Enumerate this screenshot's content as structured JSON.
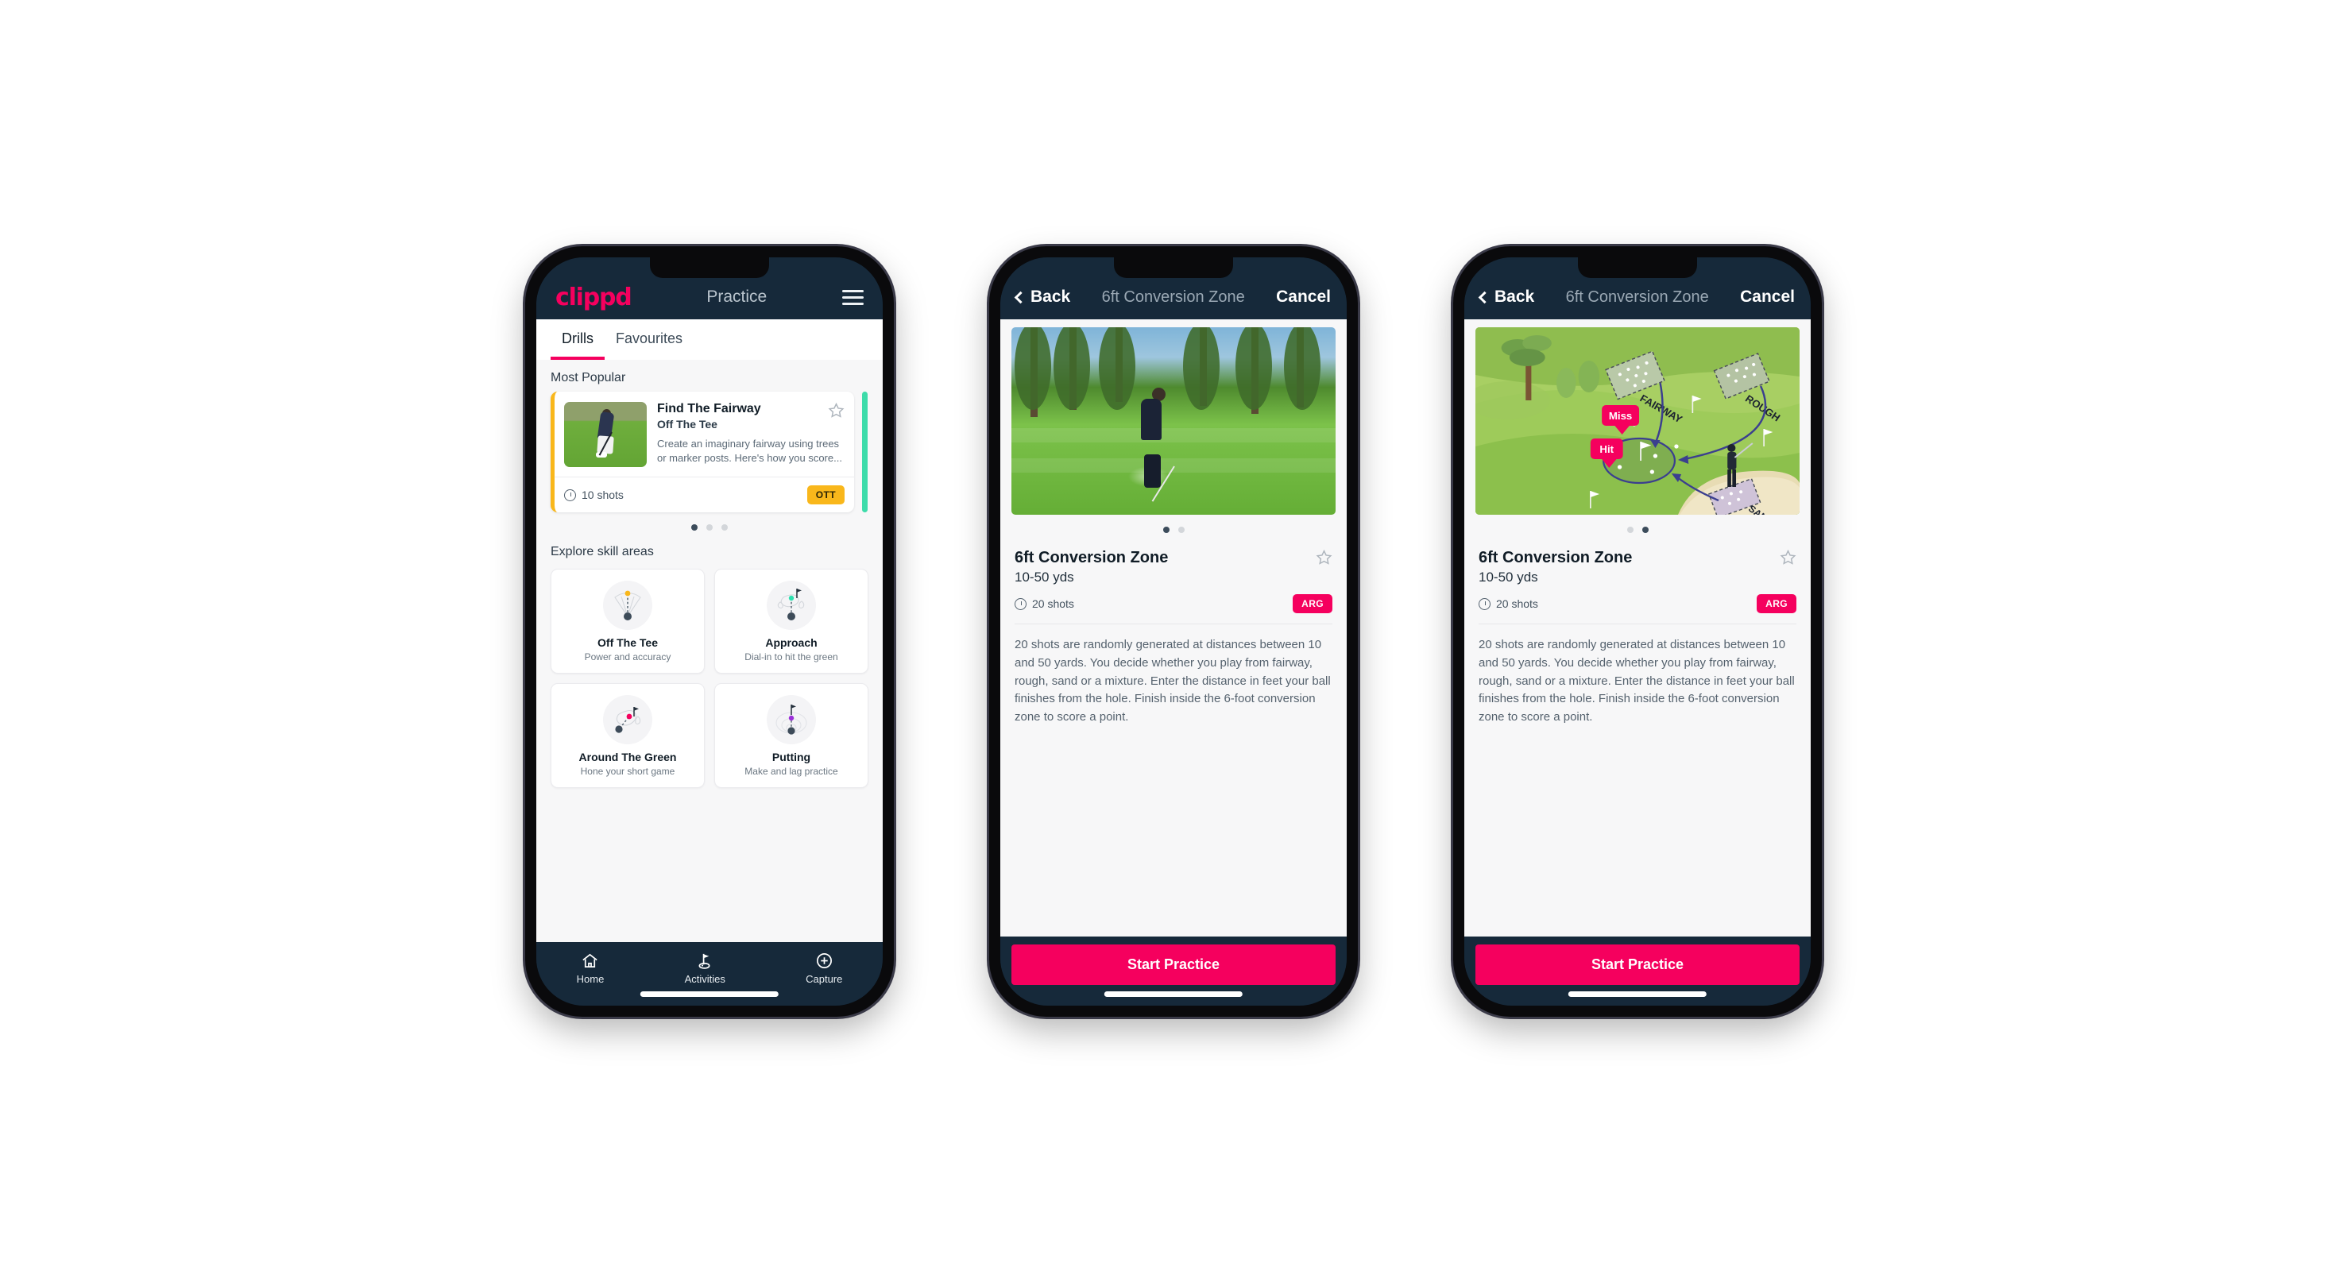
{
  "phone1": {
    "header": {
      "logo": "clippd",
      "title": "Practice",
      "menu_icon": "hamburger-menu-icon"
    },
    "tabs": [
      {
        "label": "Drills",
        "active": true
      },
      {
        "label": "Favourites",
        "active": false
      }
    ],
    "most_popular_label": "Most Popular",
    "featured_card": {
      "title": "Find The Fairway",
      "subtitle": "Off The Tee",
      "description": "Create an imaginary fairway using trees or marker posts. Here's how you score...",
      "shots": "10 shots",
      "badge": "OTT",
      "badge_color": "#f9b71b",
      "accent_color": "#f9b71b",
      "next_card_color": "#3ddcaa",
      "star_icon": "star-outline-icon",
      "thumbnail": "golfer-driving-photo"
    },
    "carousel_dots": {
      "count": 3,
      "active_index": 0
    },
    "explore_label": "Explore skill areas",
    "skills": [
      {
        "name": "Off The Tee",
        "desc": "Power and accuracy",
        "icon": "tee-dispersion-icon",
        "dot_color": "#f9b71b"
      },
      {
        "name": "Approach",
        "desc": "Dial-in to hit the green",
        "icon": "approach-green-icon",
        "dot_color": "#2ee0b0"
      },
      {
        "name": "Around The Green",
        "desc": "Hone your short game",
        "icon": "around-green-icon",
        "dot_color": "#f5005e"
      },
      {
        "name": "Putting",
        "desc": "Make and lag practice",
        "icon": "putting-rings-icon",
        "dot_color": "#9b30d9"
      }
    ],
    "bottom_nav": [
      {
        "label": "Home",
        "icon": "home-icon",
        "active": false
      },
      {
        "label": "Activities",
        "icon": "golf-flag-icon",
        "active": true
      },
      {
        "label": "Capture",
        "icon": "plus-circle-icon",
        "active": false
      }
    ]
  },
  "phone2": {
    "nav": {
      "back": "Back",
      "title": "6ft Conversion Zone",
      "cancel": "Cancel",
      "back_icon": "chevron-left-icon"
    },
    "media": "golfer-chipping-photo",
    "carousel_dots": {
      "count": 2,
      "active_index": 0
    },
    "detail": {
      "title": "6ft Conversion Zone",
      "subtitle": "10-50 yds",
      "shots": "20 shots",
      "badge": "ARG",
      "badge_color": "#f5005e",
      "star_icon": "star-outline-icon",
      "description": "20 shots are randomly generated at distances between 10 and 50 yards. You decide whether you play from fairway, rough, sand or a mixture. Enter the distance in feet your ball finishes from the hole. Finish inside the 6-foot conversion zone to score a point."
    },
    "cta": {
      "label": "Start Practice",
      "color": "#f5005e"
    }
  },
  "phone3": {
    "nav": {
      "back": "Back",
      "title": "6ft Conversion Zone",
      "cancel": "Cancel",
      "back_icon": "chevron-left-icon"
    },
    "media": "course-diagram-illustration",
    "illustration_labels": {
      "fairway": "FAIRWAY",
      "rough": "ROUGH",
      "sand": "SAND",
      "miss": "Miss",
      "hit": "Hit"
    },
    "carousel_dots": {
      "count": 2,
      "active_index": 1
    },
    "detail": {
      "title": "6ft Conversion Zone",
      "subtitle": "10-50 yds",
      "shots": "20 shots",
      "badge": "ARG",
      "badge_color": "#f5005e",
      "star_icon": "star-outline-icon",
      "description": "20 shots are randomly generated at distances between 10 and 50 yards. You decide whether you play from fairway, rough, sand or a mixture. Enter the distance in feet your ball finishes from the hole. Finish inside the 6-foot conversion zone to score a point."
    },
    "cta": {
      "label": "Start Practice",
      "color": "#f5005e"
    }
  }
}
